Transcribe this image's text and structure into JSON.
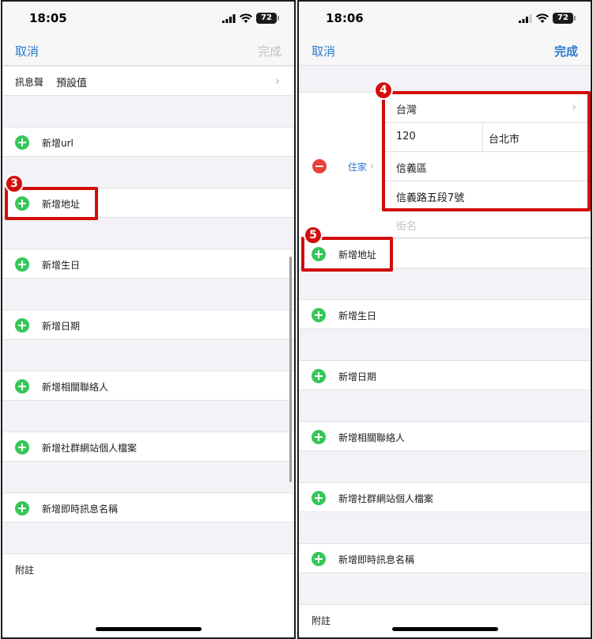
{
  "status": {
    "time_left": "18:05",
    "time_right": "18:06",
    "battery": "72"
  },
  "nav": {
    "cancel": "取消",
    "done": "完成"
  },
  "left": {
    "ringtone": {
      "label": "訊息聲",
      "value": "預設值"
    },
    "rows": [
      "新增url",
      "新增地址",
      "新增生日",
      "新增日期",
      "新增相關聯絡人",
      "新增社群網站個人檔案",
      "新增即時訊息名稱"
    ],
    "notes": "附註",
    "step": "3"
  },
  "right": {
    "address": {
      "label": "住家",
      "country": "台灣",
      "postal_code": "120",
      "city": "台北市",
      "district": "信義區",
      "street": "信義路五段7號",
      "street_placeholder": "街名"
    },
    "rows": [
      "新增地址",
      "新增生日",
      "新增日期",
      "新增相關聯絡人",
      "新增社群網站個人檔案",
      "新增即時訊息名稱"
    ],
    "notes": "附註",
    "step_address": "4",
    "step_add": "5"
  },
  "colors": {
    "accent": "#2a7ad2",
    "add_green": "#34c759",
    "delete_red": "#e5413a",
    "highlight": "#d30d0d"
  }
}
